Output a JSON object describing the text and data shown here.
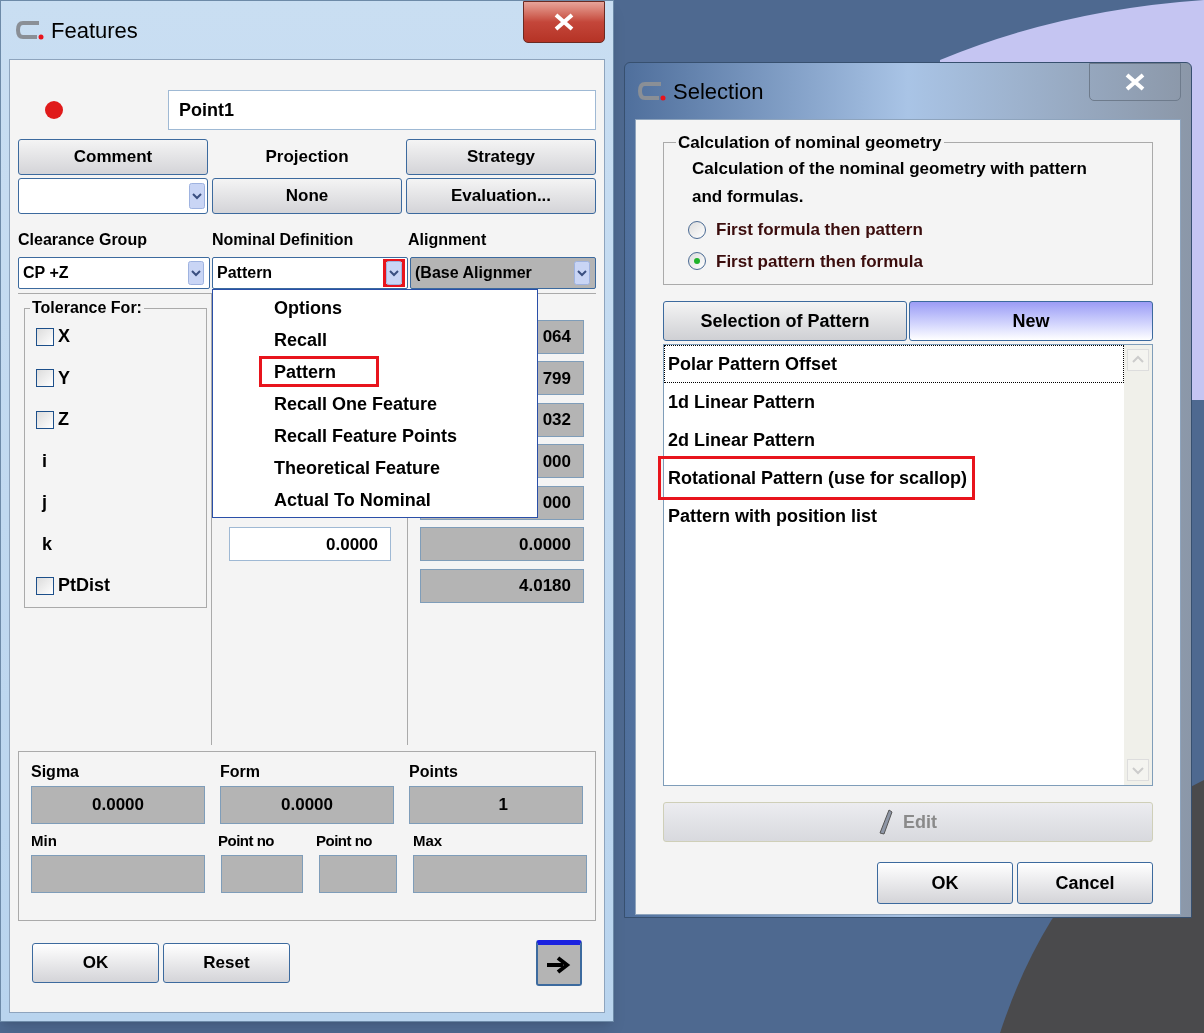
{
  "features": {
    "title": "Features",
    "name": "Point1",
    "comment_button": "Comment",
    "projection_label": "Projection",
    "strategy_button": "Strategy",
    "projection_button": "None",
    "evaluation_button": "Evaluation...",
    "clearance_label": "Clearance Group",
    "nominal_label": "Nominal Definition",
    "alignment_label": "Alignment",
    "clearance_select": {
      "value": "CP +Z"
    },
    "nominal_select": {
      "value": "Pattern",
      "arrow_highlighted": true
    },
    "alignment_select": {
      "value": "(Base Alignmer",
      "disabled": true
    },
    "tolerance": {
      "title": "Tolerance For:",
      "rows": [
        {
          "kind": "checkbox",
          "label": "X",
          "checked": false,
          "value": "064"
        },
        {
          "kind": "checkbox",
          "label": "Y",
          "checked": false,
          "value": "799"
        },
        {
          "kind": "checkbox",
          "label": "Z",
          "checked": false,
          "value": "032"
        },
        {
          "kind": "plain",
          "label": "i",
          "value": "000"
        },
        {
          "kind": "plain",
          "label": "j",
          "value": "000"
        },
        {
          "kind": "plain",
          "label": "k",
          "nominal": "0.0000",
          "value": "0.0000"
        },
        {
          "kind": "checkbox",
          "label": "PtDist",
          "checked": false,
          "value": "4.0180"
        }
      ]
    },
    "nominal_menu": {
      "items": [
        {
          "label": "Options",
          "highlighted": false
        },
        {
          "label": "Recall",
          "highlighted": false
        },
        {
          "label": "Pattern",
          "highlighted": true
        },
        {
          "label": "Recall One Feature",
          "highlighted": false
        },
        {
          "label": "Recall Feature Points",
          "highlighted": false
        },
        {
          "label": "Theoretical Feature",
          "highlighted": false
        },
        {
          "label": "Actual To Nominal",
          "highlighted": false
        }
      ]
    },
    "stats": {
      "fields": [
        {
          "label": "Sigma",
          "value": "0.0000"
        },
        {
          "label": "Form",
          "value": "0.0000"
        },
        {
          "label": "Points",
          "value": "1"
        }
      ],
      "extremes": [
        "Min",
        "Point no",
        "Point no",
        "Max"
      ]
    },
    "footer_buttons": [
      "OK",
      "Reset"
    ]
  },
  "selection": {
    "title": "Selection",
    "group_title": "Calculation of nominal geometry",
    "description": "Calculation of the nominal geometry with pattern and formulas.",
    "radios": [
      {
        "label": "First formula then pattern",
        "selected": false
      },
      {
        "label": "First pattern then formula",
        "selected": true
      }
    ],
    "tabs": [
      {
        "label": "Selection of Pattern",
        "selected": false
      },
      {
        "label": "New",
        "selected": true
      }
    ],
    "patterns": [
      {
        "label": "Polar Pattern Offset",
        "focused": true,
        "highlighted": false
      },
      {
        "label": "1d Linear Pattern",
        "focused": false,
        "highlighted": false
      },
      {
        "label": "2d Linear Pattern",
        "focused": false,
        "highlighted": false
      },
      {
        "label": "Rotational Pattern (use for scallop)",
        "focused": false,
        "highlighted": true
      },
      {
        "label": "Pattern with position list",
        "focused": false,
        "highlighted": false
      }
    ],
    "edit_button": {
      "label": "Edit",
      "disabled": true
    },
    "buttons": [
      "OK",
      "Cancel"
    ]
  }
}
